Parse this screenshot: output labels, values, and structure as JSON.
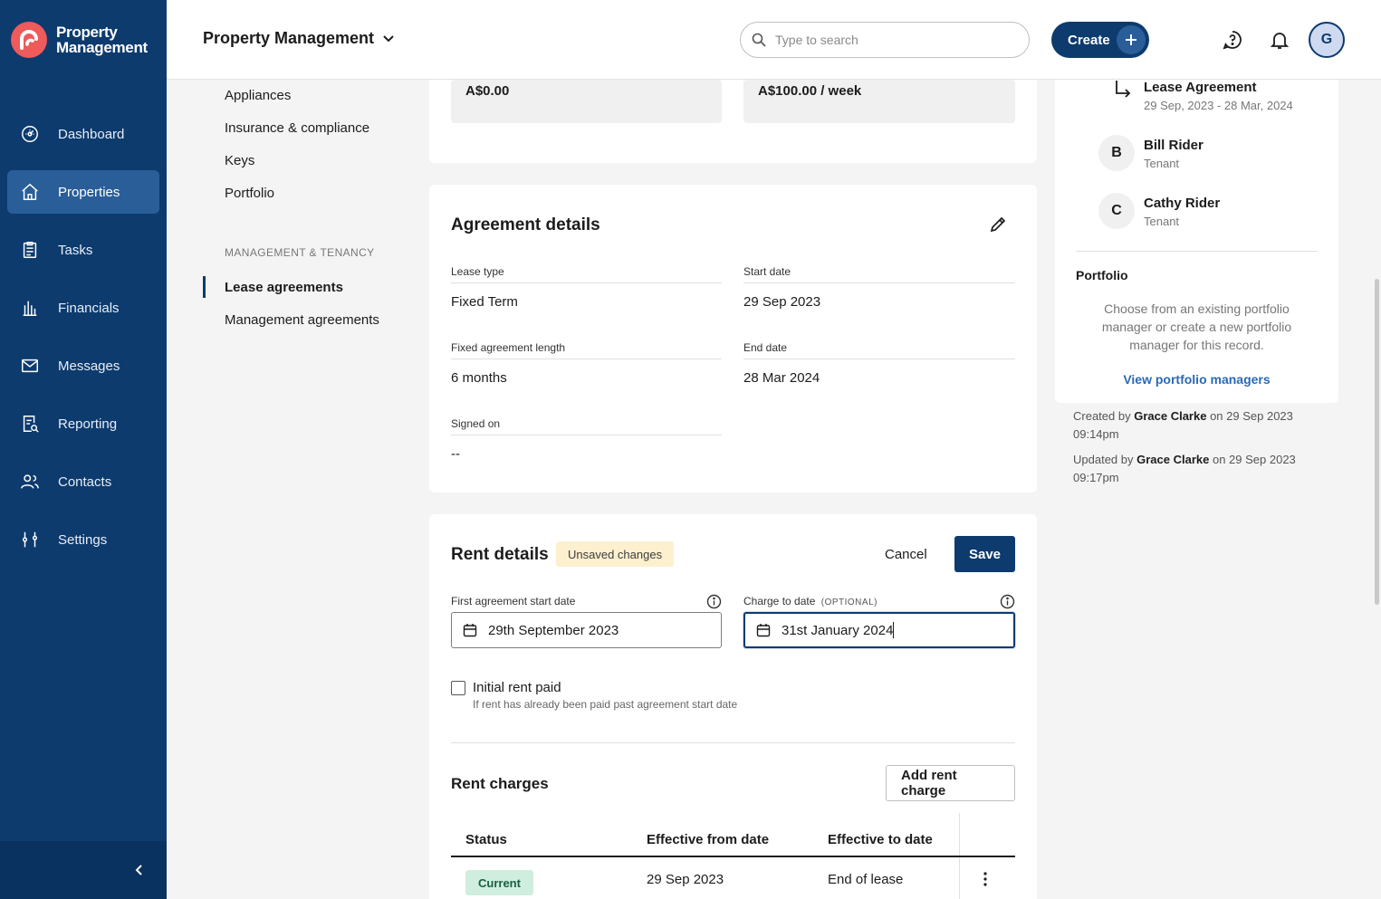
{
  "brand": {
    "line1": "Property",
    "line2": "Management"
  },
  "nav": [
    {
      "label": "Dashboard",
      "icon": "dashboard-icon"
    },
    {
      "label": "Properties",
      "icon": "home-icon",
      "active": true
    },
    {
      "label": "Tasks",
      "icon": "clipboard-icon"
    },
    {
      "label": "Financials",
      "icon": "bank-icon"
    },
    {
      "label": "Messages",
      "icon": "mail-icon"
    },
    {
      "label": "Reporting",
      "icon": "report-icon"
    },
    {
      "label": "Contacts",
      "icon": "users-icon"
    },
    {
      "label": "Settings",
      "icon": "sliders-icon"
    }
  ],
  "header": {
    "title": "Property Management",
    "search_placeholder": "Type to search",
    "create_label": "Create",
    "avatar_initial": "G"
  },
  "subnav": {
    "items_top": [
      "Appliances",
      "Insurance & compliance",
      "Keys",
      "Portfolio"
    ],
    "section_title": "MANAGEMENT & TENANCY",
    "items_section": [
      "Lease agreements",
      "Management agreements"
    ],
    "active": "Lease agreements"
  },
  "amounts": {
    "left": "A$0.00",
    "right": "A$100.00 / week"
  },
  "agreement": {
    "title": "Agreement details",
    "fields": {
      "lease_type_label": "Lease type",
      "lease_type": "Fixed Term",
      "start_date_label": "Start date",
      "start_date": "29 Sep 2023",
      "length_label": "Fixed agreement length",
      "length": "6 months",
      "end_date_label": "End date",
      "end_date": "28 Mar 2024",
      "signed_on_label": "Signed on",
      "signed_on": "--"
    }
  },
  "rent": {
    "title": "Rent details",
    "badge": "Unsaved changes",
    "cancel_label": "Cancel",
    "save_label": "Save",
    "first_start_label": "First agreement start date",
    "first_start_value": "29th September 2023",
    "charge_to_label": "Charge to date",
    "charge_to_optional": "(OPTIONAL)",
    "charge_to_value": "31st January 2024",
    "initial_rent_label": "Initial rent paid",
    "initial_rent_help": "If rent has already been paid past agreement start date",
    "initial_rent_checked": false,
    "charges_title": "Rent charges",
    "add_charge_label": "Add rent charge",
    "table": {
      "headers": [
        "Status",
        "Effective from date",
        "Effective to date"
      ],
      "rows": [
        {
          "status": "Current",
          "from": "29 Sep 2023",
          "to": "End of lease"
        }
      ]
    }
  },
  "right_panel": {
    "lease_title": "Lease Agreement",
    "lease_dates": "29 Sep, 2023 - 28 Mar, 2024",
    "tenants": [
      {
        "initial": "B",
        "name": "Bill Rider",
        "role": "Tenant"
      },
      {
        "initial": "C",
        "name": "Cathy Rider",
        "role": "Tenant"
      }
    ],
    "portfolio_title": "Portfolio",
    "portfolio_text": "Choose from an existing portfolio manager or create a new portfolio manager for this record.",
    "portfolio_link": "View portfolio managers"
  },
  "audit": {
    "created_prefix": "Created by",
    "created_by": "Grace Clarke",
    "created_on": "on 29 Sep 2023",
    "created_time": "09:14pm",
    "updated_prefix": "Updated by",
    "updated_by": "Grace Clarke",
    "updated_on": "on 29 Sep 2023",
    "updated_time": "09:17pm"
  },
  "colors": {
    "primary": "#0d3b6e",
    "brand_logo": "#ef5a5a",
    "active_nav": "#2a5e98",
    "unsaved_badge": "#fdf0cf",
    "current_badge": "#cfeee0",
    "link": "#2a6ab5"
  }
}
